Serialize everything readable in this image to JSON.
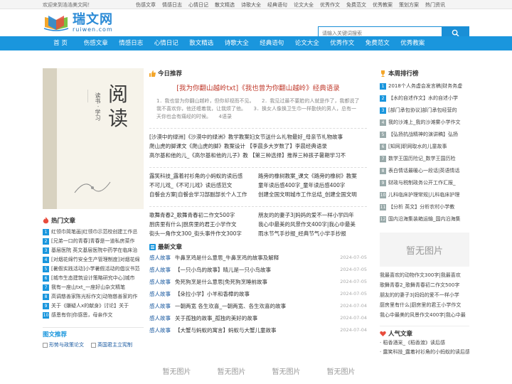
{
  "topbar": {
    "welcome": "欢迎来到浩浩美文网！",
    "links": [
      "伤感文章",
      "情感日志",
      "心情日记",
      "散文精选",
      "诗歌大全",
      "经典语句",
      "论文大全",
      "优秀作文",
      "免费范文",
      "优秀教案",
      "策划方案",
      "热门资讯"
    ]
  },
  "logo": {
    "cn": "瑞文网",
    "en": "ruiwen.com"
  },
  "search": {
    "placeholder": "请输入关键词搜索"
  },
  "nav": [
    "首 页",
    "伤感文章",
    "情感日志",
    "心情日记",
    "散文精选",
    "诗歌大全",
    "经典语句",
    "论文大全",
    "优秀作文",
    "免费范文",
    "优秀教案"
  ],
  "cover": {
    "big": "阅读",
    "small": "读书 · 学习"
  },
  "today": {
    "heading": "今日推荐",
    "title": "[我为你翻山越岭txt]《我也曾为你翻山越岭》经典语录",
    "desc": "1．我也曾为你翻山越岭，但你却视而不见。　　2．我见过最不要脸的人就是作了，我都说了我不喜欢你，他还缠着我，让我烦了他。　　3．换女人像换卫生巾一样勤快的男人，总有一天你也会有痛经的时候。　　4语录"
  },
  "block1": [
    "[沙漠中的绿洲]《沙漠中的绿洲》教学教案妇女节送什么礼物最好_母亲节礼物故事",
    "爬山虎的脚课文《爬山虎的脚》教案设计 【李晨多大岁数了】李晨经典语录",
    "高尔基和他的儿_《高尔基和他的儿子》教 【第三种选择】推荐三种孩子暑期学习不"
  ],
  "block2": {
    "left": [
      "露笑科技_露着衬衫角的小蚂蚁的读后感",
      "不可儿戏_《不可儿戏》读后感范文",
      "自餐会方案|自餐会学习部副部长个人工作"
    ],
    "right": [
      "路旁的橡树教案_课文《路旁的橡树》教案",
      "童年读后感400字_童年读后感400字",
      "创建全国文明城市工作总结_创建全国文明"
    ]
  },
  "block3": {
    "left": [
      "歌舞青春2_歌舞青春初二作文500字",
      "厨房里有什么|厨房里的君王小学作文",
      "街头一角作文300_街头事件作文300字"
    ],
    "right": [
      "朋友的的妻子3|妈妈的爱不一样小学四年",
      "我心中最美的风景作文400字|我心中最美",
      "雨水节气手抄报_经典节气小学手抄报"
    ]
  },
  "latest": {
    "heading": "最新文章",
    "rows": [
      {
        "cat": "感人故事",
        "title": "牛鼻烹鸡是什么意思_牛鼻烹鸡的故事及解释",
        "date": "2024-07-05"
      },
      {
        "cat": "感人故事",
        "title": "【一只小鸟的故事】晴儿是一只小鸟故事",
        "date": "2024-07-05"
      },
      {
        "cat": "感人故事",
        "title": "免死狗烹是什么意思|免死狗烹睡前故事",
        "date": "2024-07-05"
      },
      {
        "cat": "感人故事",
        "title": "【朵拉小学】小羊和香樟的故事",
        "date": "2024-07-05"
      },
      {
        "cat": "感人故事",
        "title": "一朝两宽 各生欢喜_一朝两宽、各生欢喜的故事",
        "date": "2024-07-04"
      },
      {
        "cat": "感人故事",
        "title": "关于孤独的故事_孤独的美好的故事",
        "date": "2024-07-04"
      },
      {
        "cat": "感人故事",
        "title": "【大蟹与蚂蚁的寓言】蚂蚁与大蟹儿童故事",
        "date": "2024-07-04"
      }
    ]
  },
  "noimg_label": "暂无图片",
  "hot": {
    "heading": "热门文章",
    "items": [
      "红领巾简笔画|红领巾示范校创建工作总",
      "[兄弟一口的青春]青春是一道私房菜作",
      "基层医院 英文基层医院中药学在临床治",
      "[对烟花绵竹安全生产管理制度]对烟花绵",
      "[暑假实践活动]小学暑假活动的倡议书范",
      "[城市生态建筑设计策略研究中心]城市",
      "我有一座山txt_一座好山杂文精笔",
      "高调慈善家陈光标作文|动物慈善家的作",
      "关于《嫌疑人x的献身》讨论】关于",
      "感恩有你|你感恩，母亲作文"
    ]
  },
  "picrec": {
    "heading": "图文推荐",
    "links": [
      "形势与政策论文",
      "英国君主立宪制"
    ]
  },
  "rank": {
    "heading": "本周排行榜",
    "items": [
      "2018个人务虚会发言稿|财务务虚",
      "【水的自述作文】水的自述小学",
      "[部门承包协议]部门承包经营的",
      "我的沙滩上_我的沙滩雾小学作文",
      "【弘扬抗战精神的演讲稿】弘扬",
      "[知网]职网取水的儿童故事",
      "数学王国历险记_数学王国历险",
      "表白情话最暖心一段话|英语情话",
      "财政与税制政务公开工作汇报_",
      "儿科临床护理常规|儿科临床护理",
      "【分析 英文】分析农村小学教",
      "国内沿海集装箱运输_国内沿海集"
    ]
  },
  "rlist": [
    "我最喜欢的动物作文300字|我最喜欢",
    "歌舞青春2_歌舞青春初二作文500字",
    "朋友的的妻子3|妈妈的爱不一样小学",
    "厨房里有什么|厨房里的君王小学作文",
    "我心中最美的风景作文400字|我心中最"
  ],
  "popular": {
    "heading": "人气文章",
    "items": [
      "稻香酒采_《稻香渡》读后感",
      "露笑科技_露着衬衫角的小蚂蚁的读后感"
    ]
  }
}
